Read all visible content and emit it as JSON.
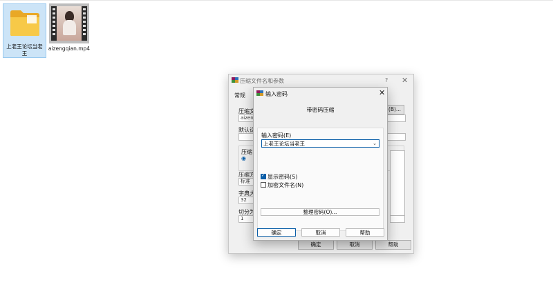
{
  "desktop": {
    "folder": {
      "label": "上老王论坛当老王"
    },
    "video": {
      "label": "aizengqian.mp4"
    }
  },
  "background_dialog": {
    "title": "压缩文件名和参数",
    "help": "?",
    "close": "✕",
    "tab_general": "常规",
    "archive_name_label": "压缩文",
    "archive_name_value": "aizeng",
    "browse_button": "(B)...",
    "defaults_label": "默认设",
    "compress_group_label": "压缩",
    "compress_method_label": "压缩方",
    "compress_method_value": "标准",
    "dict_size_label": "字典大",
    "dict_size_value": "32",
    "split_label": "切分为",
    "split_value": "1",
    "ok": "确定",
    "cancel": "取消",
    "help_button": "帮助"
  },
  "password_dialog": {
    "title": "输入密码",
    "close": "✕",
    "subtitle": "带密码压缩",
    "enter_label": "输入密码(E)",
    "password_value": "上老王论坛当老王",
    "show_password": {
      "label": "显示密码(S)",
      "checked": true
    },
    "encrypt_names": {
      "label": "加密文件名(N)",
      "checked": false
    },
    "organize_button": "整理密码(O)...",
    "ok": "确定",
    "cancel": "取消",
    "help": "帮助"
  },
  "colors": {
    "accent": "#0a5ea8",
    "folder_yellow": "#f5c242",
    "selection": "#cce4f7"
  }
}
